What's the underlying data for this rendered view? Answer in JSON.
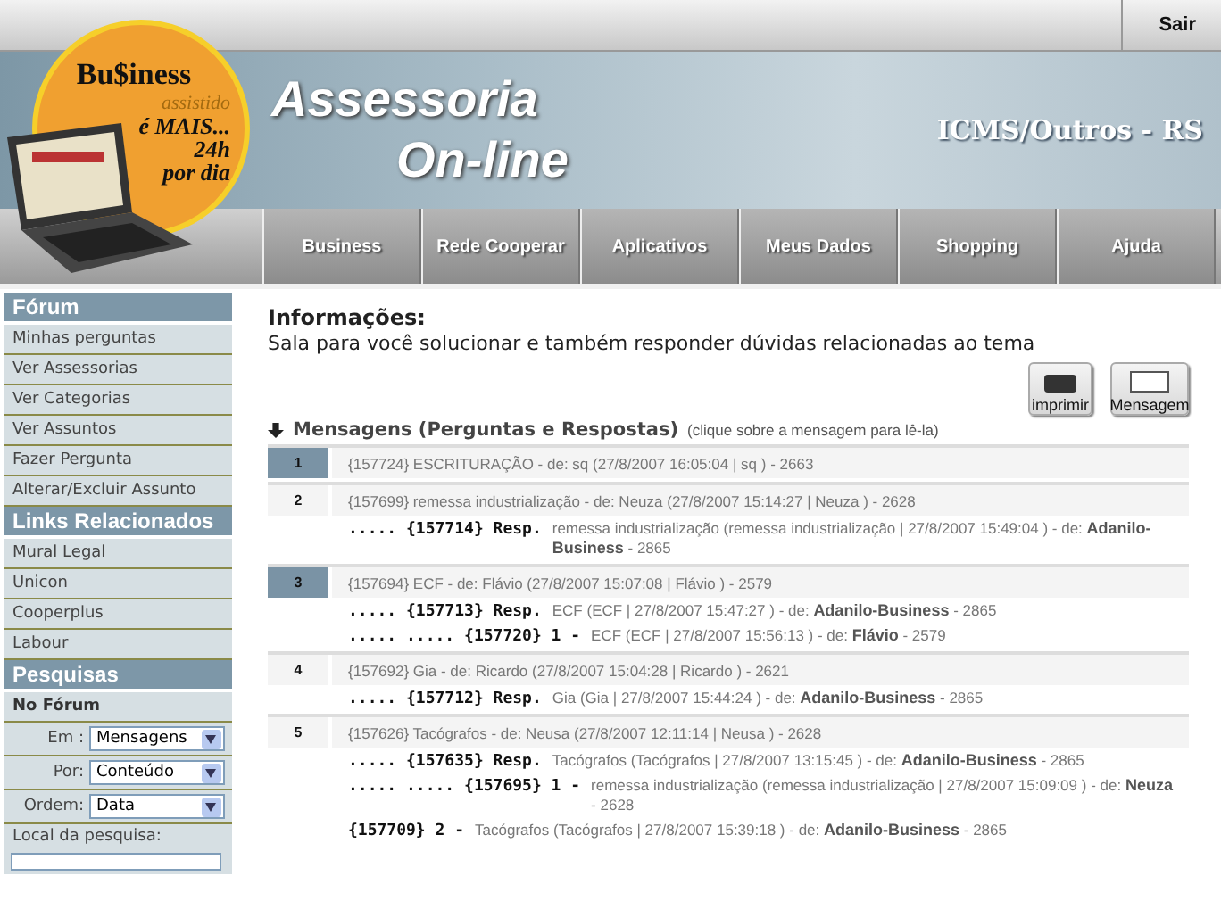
{
  "topbar": {
    "logout": "Sair"
  },
  "banner": {
    "logo_brand": "Bu$iness",
    "logo_sub": "assistido",
    "logo_slogan": [
      "é MAIS...",
      "24h",
      "por dia"
    ],
    "title_lines": [
      "Assessoria",
      "On-line"
    ],
    "section": "ICMS/Outros - RS"
  },
  "nav": [
    "Business",
    "Rede Cooperar",
    "Aplicativos",
    "Meus Dados",
    "Shopping",
    "Ajuda"
  ],
  "sidebar": [
    {
      "heading": "Fórum",
      "items": [
        "Minhas perguntas",
        "Ver Assessorias",
        "Ver Categorias",
        "Ver Assuntos",
        "Fazer Pergunta",
        "Alterar/Excluir Assunto"
      ]
    },
    {
      "heading": "Links Relacionados",
      "items": [
        "Mural Legal",
        "Unicon",
        "Cooperplus",
        "Labour"
      ]
    }
  ],
  "search": {
    "heading": "Pesquisas",
    "subheading": "No Fórum",
    "filters": [
      {
        "label": "Em :",
        "value": "Mensagens"
      },
      {
        "label": "Por:",
        "value": "Conteúdo"
      },
      {
        "label": "Ordem:",
        "value": "Data"
      }
    ],
    "location_label": "Local da pesquisa:"
  },
  "info": {
    "title": "Informações:",
    "text": "Sala para você solucionar e também responder dúvidas relacionadas ao tema"
  },
  "actions": [
    {
      "kind": "print",
      "label": "imprimir"
    },
    {
      "kind": "mail",
      "label": "Mensagem"
    }
  ],
  "messages_header": {
    "title": "Mensagens (Perguntas e Respostas)",
    "hint": "(clique sobre a mensagem para lê-la)"
  },
  "messages": [
    {
      "number": "1",
      "highlighted": true,
      "text": "{157724} ESCRITURAÇÃO - de: sq (27/8/2007  16:05:04 | sq ) - 2663"
    },
    {
      "number": "2",
      "highlighted": false,
      "text": "{157699} remessa industrialização - de: Neuza (27/8/2007  15:14:27 | Neuza ) - 2628",
      "replies": [
        {
          "prefix": "..... {157714} Resp.",
          "text": "remessa industrialização (remessa industrialização | 27/8/2007  15:49:04 ) - de: **Adanilo-Business** - 2865"
        }
      ]
    },
    {
      "number": "3",
      "highlighted": true,
      "text": "{157694} ECF - de: Flávio (27/8/2007  15:07:08 | Flávio ) - 2579",
      "replies": [
        {
          "prefix": "..... {157713} Resp.",
          "text": "ECF (ECF | 27/8/2007  15:47:27 ) - de: **Adanilo-Business** - 2865"
        },
        {
          "prefix": "..... ..... {157720} 1 -",
          "text": "ECF (ECF | 27/8/2007  15:56:13 ) - de: **Flávio** - 2579"
        }
      ]
    },
    {
      "number": "4",
      "highlighted": false,
      "text": "{157692} Gia - de: Ricardo (27/8/2007  15:04:28 | Ricardo ) - 2621",
      "replies": [
        {
          "prefix": "..... {157712} Resp.",
          "text": "Gia (Gia | 27/8/2007  15:44:24 ) - de: **Adanilo-Business** - 2865"
        }
      ]
    },
    {
      "number": "5",
      "highlighted": false,
      "text": "{157626} Tacógrafos - de: Neusa (27/8/2007  12:11:14 | Neusa ) - 2628",
      "replies": [
        {
          "prefix": "..... {157635} Resp.",
          "text": "Tacógrafos (Tacógrafos | 27/8/2007  13:15:45 ) - de: **Adanilo-Business** - 2865"
        },
        {
          "prefix": "..... ..... {157695} 1 -",
          "text": "remessa industrialização (remessa industrialização | 27/8/2007  15:09:09 ) - de: **Neuza** - 2628"
        },
        {
          "prefix": "{157709} 2 -",
          "text": "Tacógrafos (Tacógrafos | 27/8/2007  15:39:18 ) - de: **Adanilo-Business** - 2865"
        }
      ]
    }
  ]
}
